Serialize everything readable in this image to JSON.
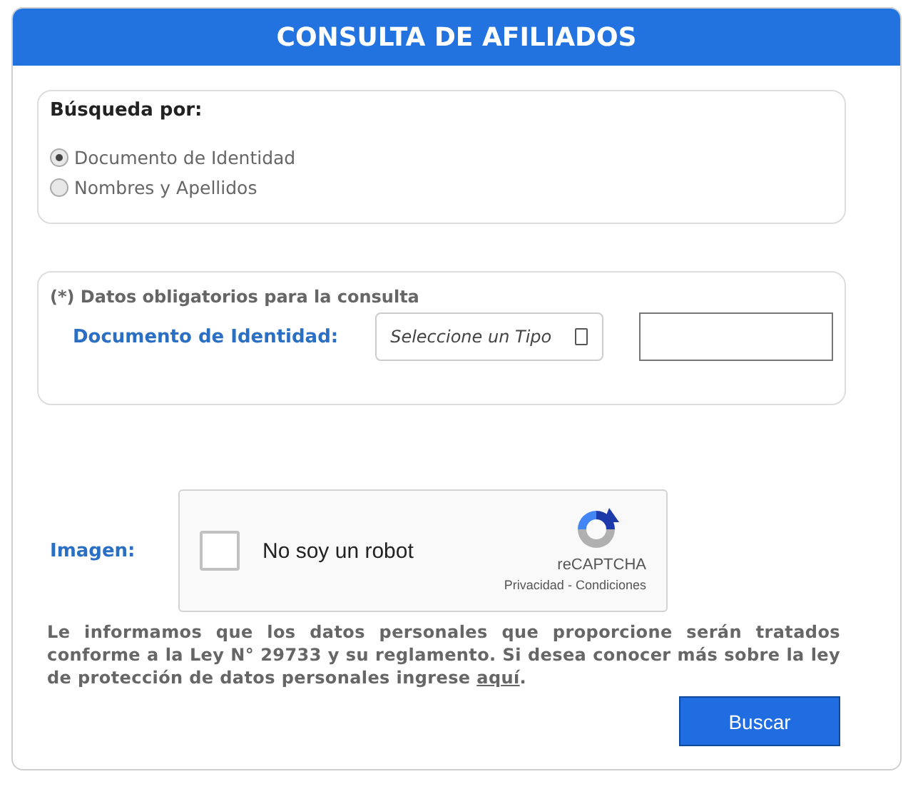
{
  "header": {
    "title": "CONSULTA DE AFILIADOS"
  },
  "search_by": {
    "label": "Búsqueda por:",
    "options": [
      {
        "label": "Documento de Identidad",
        "selected": true
      },
      {
        "label": "Nombres y Apellidos",
        "selected": false
      }
    ]
  },
  "required": {
    "note": "(*) Datos obligatorios para la consulta",
    "field_label": "Documento de Identidad:",
    "select_placeholder": "Seleccione un Tipo"
  },
  "captcha": {
    "label": "Imagen:",
    "checkbox_label": "No soy un robot",
    "checked": false,
    "brand": "reCAPTCHA",
    "privacy": "Privacidad",
    "separator": "-",
    "terms": "Condiciones"
  },
  "notice": {
    "text": "Le informamos que los datos personales que proporcione serán tratados conforme a la Ley N° 29733 y su reglamento. Si desea conocer más sobre la ley de protección de datos personales ingrese ",
    "link": "aquí",
    "after": "."
  },
  "button": "Buscar"
}
